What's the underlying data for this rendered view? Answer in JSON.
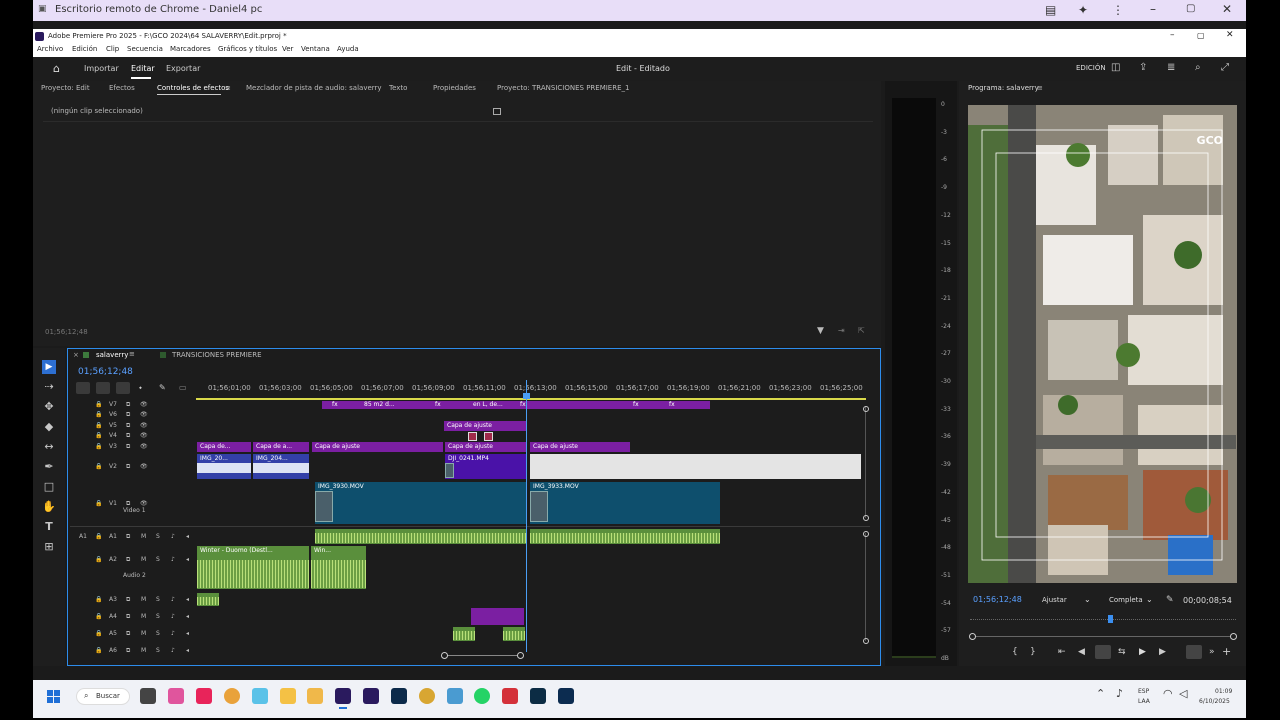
{
  "chrome": {
    "title": "Escritorio remoto de Chrome - Daniel4 pc"
  },
  "app": {
    "title": "Adobe Premiere Pro 2025 - F:\\GCO 2024\\64 SALAVERRY\\Edit.prproj *",
    "menu": [
      "Archivo",
      "Edición",
      "Clip",
      "Secuencia",
      "Marcadores",
      "Gráficos y títulos",
      "Ver",
      "Ventana",
      "Ayuda"
    ],
    "header": {
      "import": "Importar",
      "edit": "Editar",
      "export": "Exportar",
      "center": "Edit - Editado",
      "workspace": "EDICIÓN"
    }
  },
  "panel_tabs": [
    "Proyecto: Edit",
    "Efectos",
    "Controles de efectos",
    "Mezclador de pista de audio: salaverry",
    "Texto",
    "Propiedades",
    "Proyecto: TRANSICIONES PREMIERE_1"
  ],
  "effect_controls": {
    "no_clip": "(ningún clip seleccionado)",
    "timecode": "01;56;12;48"
  },
  "meter": {
    "labels": [
      "0",
      "-3",
      "-6",
      "-9",
      "-12",
      "-15",
      "-18",
      "-21",
      "-24",
      "-27",
      "-30",
      "-33",
      "-36",
      "-39",
      "-42",
      "-45",
      "-48",
      "-51",
      "-54",
      "-57",
      "dB"
    ]
  },
  "program": {
    "title": "Programa: salaverry",
    "timecode": "01;56;12;48",
    "fit": "Ajustar",
    "quality": "Completa",
    "duration": "00;00;08;54",
    "watermark": "GCO"
  },
  "sequence": {
    "tabs": [
      "salaverry",
      "TRANSICIONES PREMIERE"
    ],
    "timecode": "01;56;12;48",
    "ruler": [
      "01;56;01;00",
      "01;56;03;00",
      "01;56;05;00",
      "01;56;07;00",
      "01;56;09;00",
      "01;56;11;00",
      "01;56;13;00",
      "01;56;15;00",
      "01;56;17;00",
      "01;56;19;00",
      "01;56;21;00",
      "01;56;23;00",
      "01;56;25;00"
    ],
    "video_tracks": [
      "V7",
      "V6",
      "V5",
      "V4",
      "V3",
      "V2",
      "V1"
    ],
    "v1_name": "Video 1",
    "audio_tracks": [
      "A1",
      "A2",
      "A3",
      "A4",
      "A5",
      "A6"
    ],
    "a2_name": "Audio 2",
    "clips": {
      "v7a": "fx",
      "v7b": "85 m2 d...",
      "v7c": "fx",
      "v7d": "en L, de...",
      "v7e": "fx",
      "v7f": "fx",
      "v7g": "fx",
      "v5": "Capa de ajuste",
      "v3a": "Capa de...",
      "v3b": "Capa de a...",
      "v3c": "Capa de ajuste",
      "v3d": "Capa de ajuste",
      "v3e": "Capa de ajuste",
      "v2a": "IMG_20...",
      "v2b": "IMG_204...",
      "v2c": "DJI_0241.MP4",
      "v1a": "IMG_3930.MOV",
      "v1b": "IMG_3933.MOV",
      "a2a": "Winter - Duomo (Destl...",
      "a2b": "Win..."
    }
  },
  "taskbar": {
    "search": "Buscar",
    "lang": "ESP",
    "lang2": "LAA",
    "time": "01:09",
    "date": "6/10/2025"
  }
}
